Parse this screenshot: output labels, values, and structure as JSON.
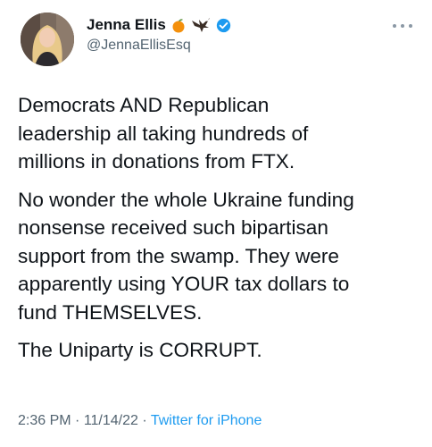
{
  "author": {
    "display_name": "Jenna Ellis",
    "handle": "@JennaEllisEsq",
    "name_emojis": [
      "peach-emoji",
      "eagle-emoji"
    ],
    "verified_color": "#1d9bf0"
  },
  "tweet": {
    "paragraphs": [
      "Democrats AND Republican\nleadership all taking hundreds of\nmillions in donations from FTX.",
      "No wonder the whole Ukraine funding\nnonsense received such bipartisan\nsupport from the swamp. They were\napparently using YOUR tax dollars to\nfund THEMSELVES.",
      "The Uniparty is CORRUPT."
    ]
  },
  "meta": {
    "time": "2:36 PM",
    "sep1": " · ",
    "date": "11/14/22",
    "sep2": " · ",
    "source": "Twitter for iPhone"
  },
  "colors": {
    "text": "#0f1419",
    "secondary": "#536471",
    "link": "#1d9bf0"
  }
}
